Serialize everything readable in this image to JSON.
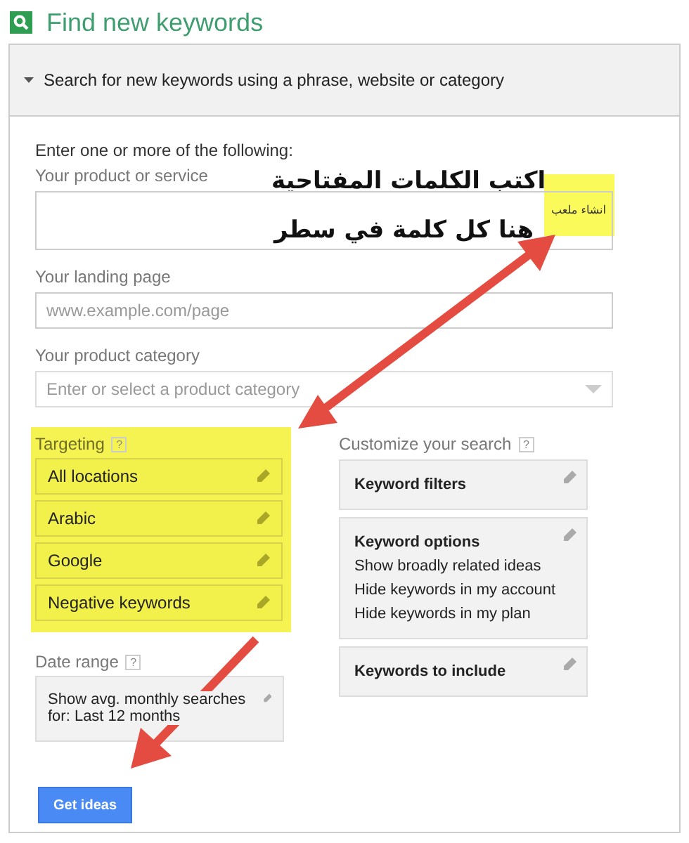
{
  "page_title": "Find new keywords",
  "panel": {
    "heading": "Search for new keywords using a phrase, website or category",
    "expanded": true
  },
  "form": {
    "intro": "Enter one or more of the following:",
    "product": {
      "label": "Your product or service",
      "value": "انشاء ملعب",
      "highlighted": true
    },
    "landing": {
      "label": "Your landing page",
      "placeholder": "www.example.com/page"
    },
    "category": {
      "label": "Your product category",
      "placeholder": "Enter or select a product category"
    }
  },
  "targeting": {
    "label": "Targeting",
    "help": "?",
    "highlighted": true,
    "items": [
      {
        "label": "All locations"
      },
      {
        "label": "Arabic"
      },
      {
        "label": "Google"
      },
      {
        "label": "Negative keywords"
      }
    ]
  },
  "date_range": {
    "label": "Date range",
    "help": "?",
    "text": "Show avg. monthly searches for: Last 12 months"
  },
  "customize": {
    "label": "Customize your search",
    "help": "?",
    "cards": [
      {
        "title": "Keyword filters"
      },
      {
        "title": "Keyword options",
        "lines": [
          "Show broadly related ideas",
          "Hide keywords in my account",
          "Hide keywords in my plan"
        ]
      },
      {
        "title": "Keywords to include"
      }
    ]
  },
  "button": "Get ideas",
  "annotations": [
    "اكتب الكلمات المفتاحية",
    "هنا كل كلمة في سطر"
  ]
}
